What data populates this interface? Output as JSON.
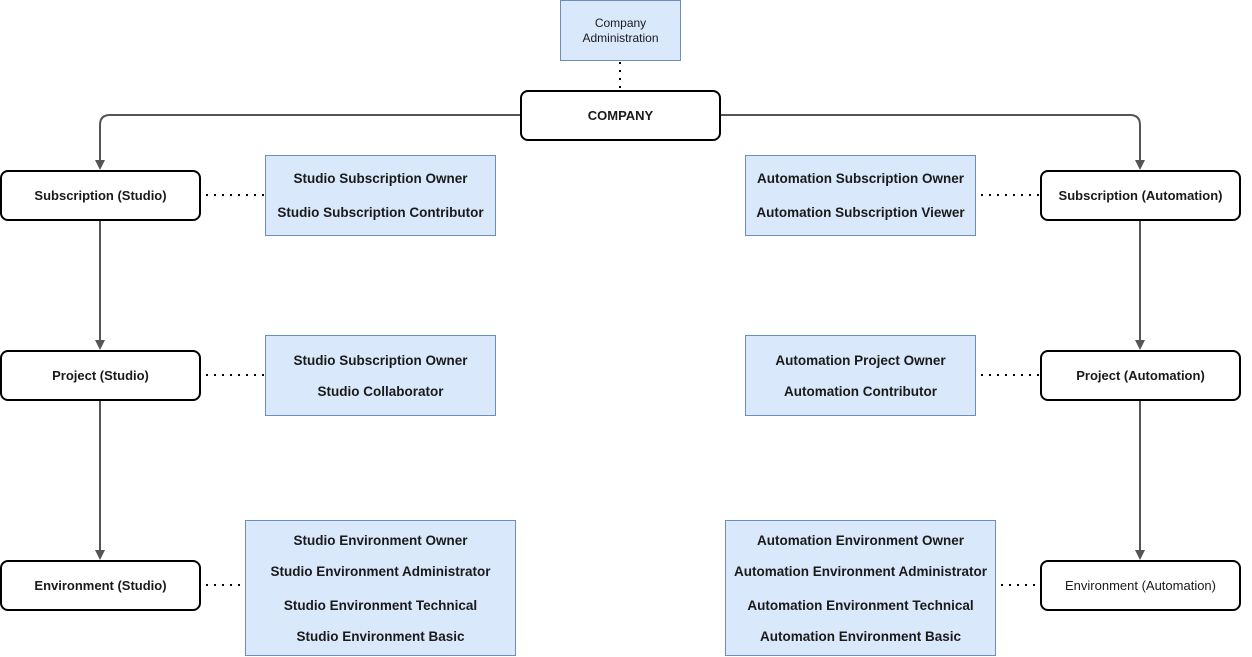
{
  "company_admin": {
    "line1": "Company",
    "line2": "Administration"
  },
  "company": "COMPANY",
  "studio": {
    "subscription": "Subscription (Studio)",
    "project": "Project (Studio)",
    "environment": "Environment (Studio)",
    "subscription_roles": [
      "Studio Subscription Owner",
      "Studio Subscription Contributor"
    ],
    "project_roles": [
      "Studio Subscription Owner",
      "Studio Collaborator"
    ],
    "environment_roles": [
      "Studio Environment Owner",
      "Studio Environment Administrator",
      "Studio Environment Technical",
      "Studio Environment Basic"
    ]
  },
  "automation": {
    "subscription": "Subscription (Automation)",
    "project": "Project (Automation)",
    "environment": "Environment (Automation)",
    "subscription_roles": [
      "Automation Subscription Owner",
      "Automation Subscription Viewer"
    ],
    "project_roles": [
      "Automation Project Owner",
      "Automation Contributor"
    ],
    "environment_roles": [
      "Automation Environment Owner",
      "Automation Environment Administrator",
      "Automation Environment Technical",
      "Automation Environment Basic"
    ]
  },
  "colors": {
    "role_fill": "#dae8fc",
    "role_stroke": "#6c8ebf",
    "edge": "#555555"
  }
}
